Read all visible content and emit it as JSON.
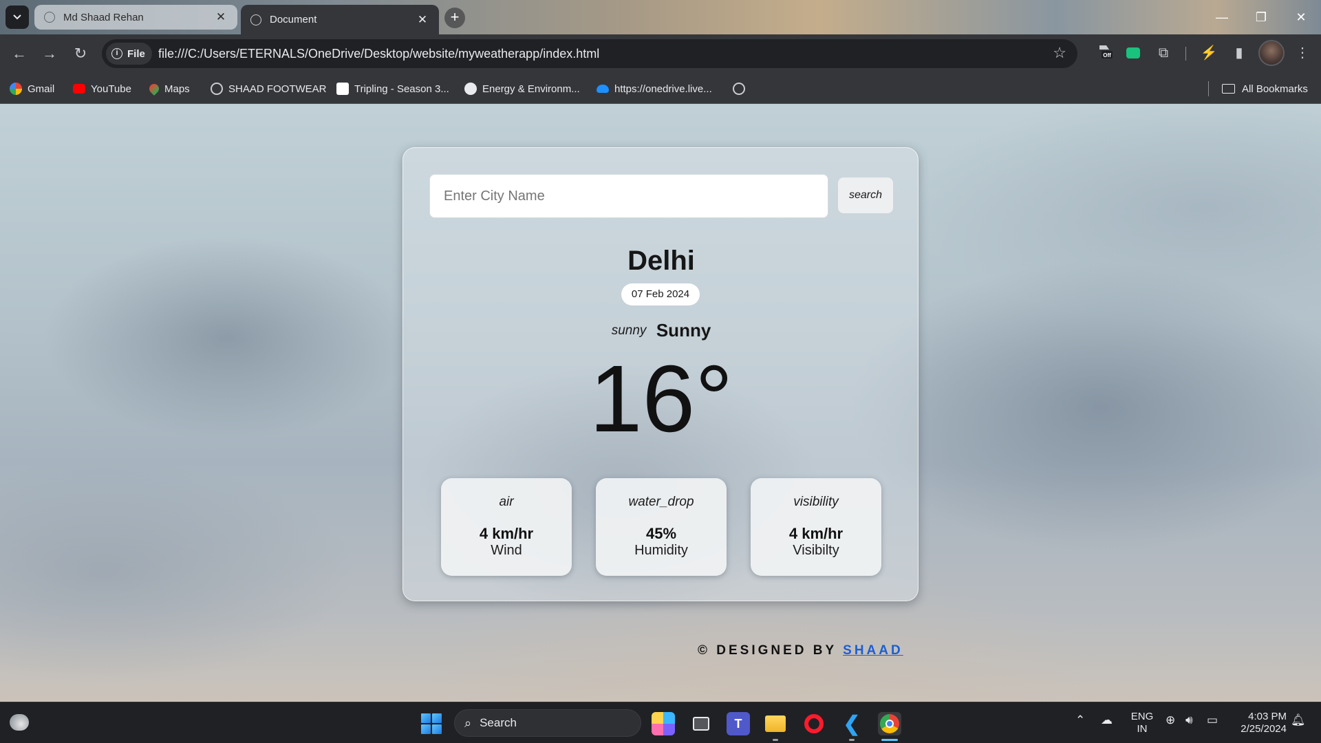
{
  "browser": {
    "tabs": [
      {
        "title": "Md Shaad Rehan",
        "active": false
      },
      {
        "title": "Document",
        "active": true
      }
    ],
    "omnibox": {
      "chip_label": "File",
      "url": "file:///C:/Users/ETERNALS/OneDrive/Desktop/website/myweatherapp/index.html"
    },
    "bookmarks": [
      {
        "label": "Gmail",
        "icon": "google-icon"
      },
      {
        "label": "YouTube",
        "icon": "youtube-icon"
      },
      {
        "label": "Maps",
        "icon": "maps-icon"
      },
      {
        "label": "SHAAD FOOTWEAR",
        "icon": "globe-icon"
      },
      {
        "label": "Tripling - Season 3...",
        "icon": "tvf-icon"
      },
      {
        "label": "Energy & Environm...",
        "icon": "energy-icon"
      },
      {
        "label": "https://onedrive.live...",
        "icon": "onedrive-icon"
      },
      {
        "label": "",
        "icon": "globe-icon"
      }
    ],
    "all_bookmarks_label": "All Bookmarks",
    "extension_badge": "Off"
  },
  "app": {
    "search": {
      "placeholder": "Enter City Name",
      "button_label": "search"
    },
    "city": "Delhi",
    "date": "07 Feb 2024",
    "condition_icon": "sunny",
    "condition": "Sunny",
    "temperature": "16°",
    "stats": [
      {
        "icon": "air",
        "value": "4 km/hr",
        "label": "Wind"
      },
      {
        "icon": "water_drop",
        "value": "45%",
        "label": "Humidity"
      },
      {
        "icon": "visibility",
        "value": "4 km/hr",
        "label": "Visibilty"
      }
    ],
    "footer": {
      "prefix": "© DESIGNED BY",
      "author": "SHAAD"
    }
  },
  "taskbar": {
    "search_label": "Search",
    "language": {
      "line1": "ENG",
      "line2": "IN"
    },
    "time": "4:03 PM",
    "date": "2/25/2024"
  },
  "colors": {
    "accent_link": "#1b5ed6",
    "chrome_dark": "#35363a",
    "taskbar": "#202124"
  }
}
